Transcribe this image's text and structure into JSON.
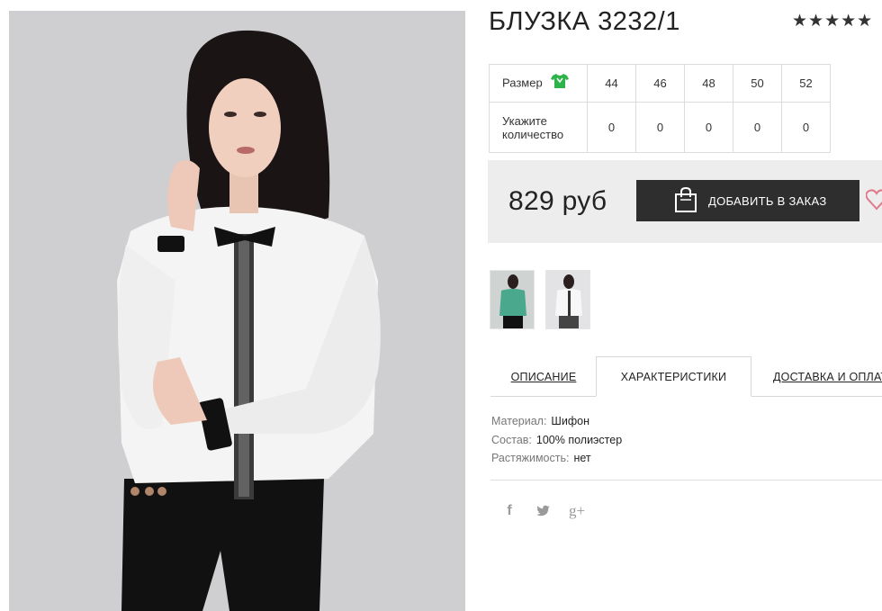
{
  "product": {
    "title": "БЛУЗКА 3232/1",
    "rating_text": "★★★★★",
    "rating": 5
  },
  "size_table": {
    "size_label": "Размер",
    "qty_label_line1": "Укажите",
    "qty_label_line2": "количество",
    "sizes": [
      "44",
      "46",
      "48",
      "50",
      "52"
    ],
    "quantities": [
      "0",
      "0",
      "0",
      "0",
      "0"
    ]
  },
  "purchase": {
    "price": "829 руб",
    "add_button": "ДОБАВИТЬ В ЗАКАЗ"
  },
  "tabs": {
    "description": "ОПИСАНИЕ",
    "characteristics": "ХАРАКТЕРИСТИКИ",
    "delivery": "ДОСТАВКА И ОПЛАТА"
  },
  "specs": {
    "material_key": "Материал:",
    "material_val": "Шифон",
    "composition_key": "Состав:",
    "composition_val": "100% полиэстер",
    "stretch_key": "Растяжимость:",
    "stretch_val": "нет"
  },
  "social": {
    "facebook": "f",
    "twitter": "🐦",
    "google": "g+"
  },
  "colors": {
    "accent_green": "#2db34a",
    "button_dark": "#2e2e2e",
    "price_bg": "#ededed",
    "heart": "#e07a8a",
    "thumb_teal": "#5a9e86"
  }
}
